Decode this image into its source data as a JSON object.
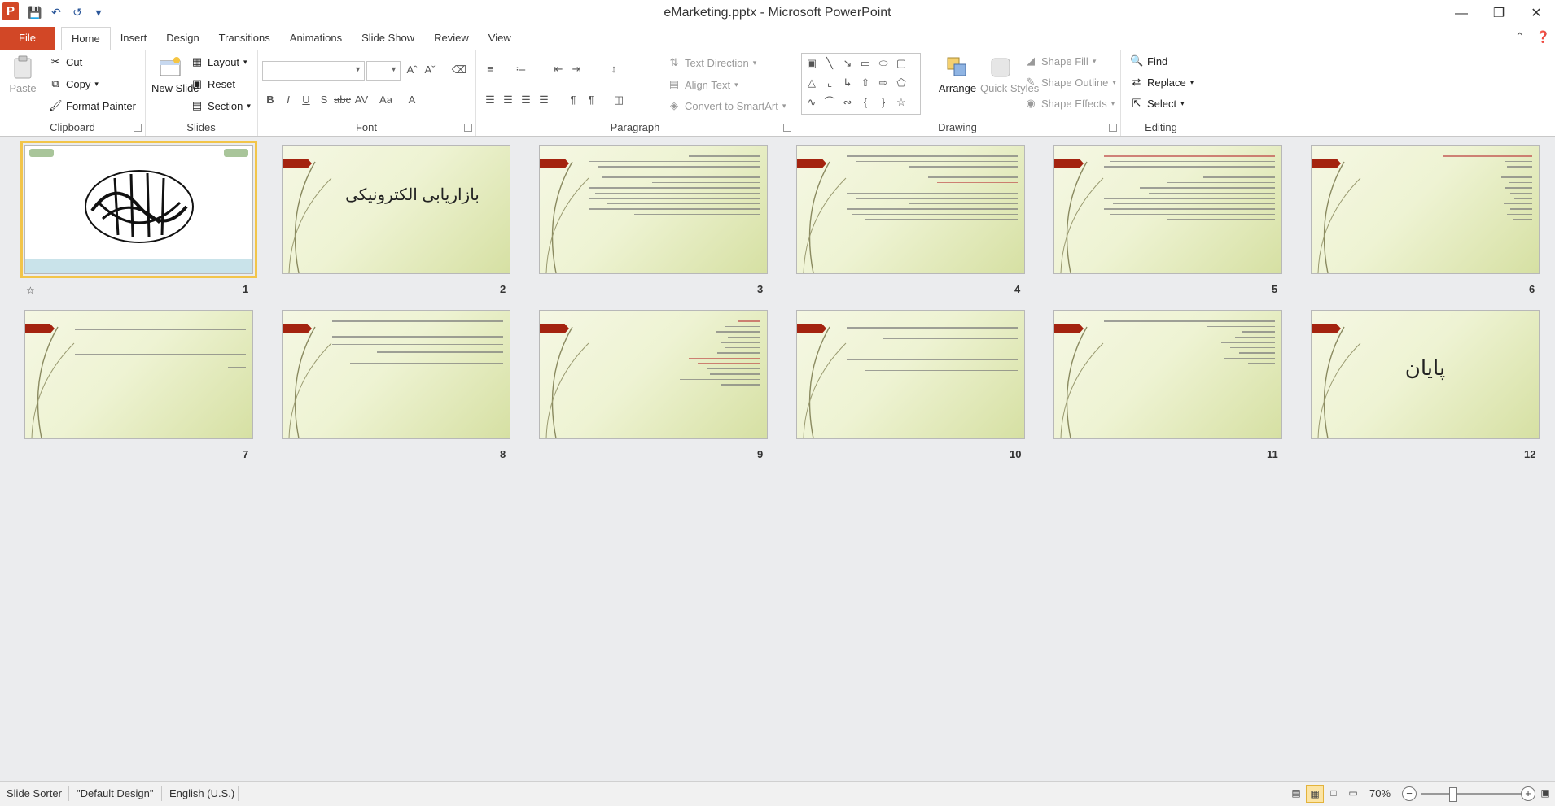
{
  "app": {
    "icon_letter": "P",
    "title": "eMarketing.pptx - Microsoft PowerPoint",
    "quick_access": [
      "save-icon",
      "undo-icon",
      "redo-icon",
      "customize-icon"
    ],
    "window_buttons": [
      "minimize-icon",
      "restore-icon",
      "close-icon"
    ]
  },
  "tabs": {
    "file": "File",
    "items": [
      "Home",
      "Insert",
      "Design",
      "Transitions",
      "Animations",
      "Slide Show",
      "Review",
      "View"
    ],
    "active": "Home"
  },
  "ribbon": {
    "clipboard": {
      "label": "Clipboard",
      "paste": "Paste",
      "cut": "Cut",
      "copy": "Copy",
      "format_painter": "Format Painter"
    },
    "slides": {
      "label": "Slides",
      "new_slide": "New Slide",
      "layout": "Layout",
      "reset": "Reset",
      "section": "Section"
    },
    "font": {
      "label": "Font",
      "font_name": "",
      "font_size": ""
    },
    "paragraph": {
      "label": "Paragraph",
      "text_direction": "Text Direction",
      "align_text": "Align Text",
      "convert_smartart": "Convert to SmartArt"
    },
    "drawing": {
      "label": "Drawing",
      "arrange": "Arrange",
      "quick_styles": "Quick Styles",
      "shape_fill": "Shape Fill",
      "shape_outline": "Shape Outline",
      "shape_effects": "Shape Effects"
    },
    "editing": {
      "label": "Editing",
      "find": "Find",
      "replace": "Replace",
      "select": "Select"
    }
  },
  "slides": [
    {
      "number": "1",
      "title": "",
      "kind": "calligraphy"
    },
    {
      "number": "2",
      "title": "بازاریابی الکترونیکی",
      "kind": "title"
    },
    {
      "number": "3",
      "title": "",
      "kind": "text"
    },
    {
      "number": "4",
      "title": "",
      "kind": "text"
    },
    {
      "number": "5",
      "title": "",
      "kind": "text"
    },
    {
      "number": "6",
      "title": "",
      "kind": "list"
    },
    {
      "number": "7",
      "title": "",
      "kind": "text"
    },
    {
      "number": "8",
      "title": "",
      "kind": "text"
    },
    {
      "number": "9",
      "title": "",
      "kind": "list"
    },
    {
      "number": "10",
      "title": "",
      "kind": "text"
    },
    {
      "number": "11",
      "title": "",
      "kind": "list"
    },
    {
      "number": "12",
      "title": "پایان",
      "kind": "end"
    }
  ],
  "status": {
    "view": "Slide Sorter",
    "theme": "\"Default Design\"",
    "language": "English (U.S.)",
    "zoom": "70%"
  }
}
